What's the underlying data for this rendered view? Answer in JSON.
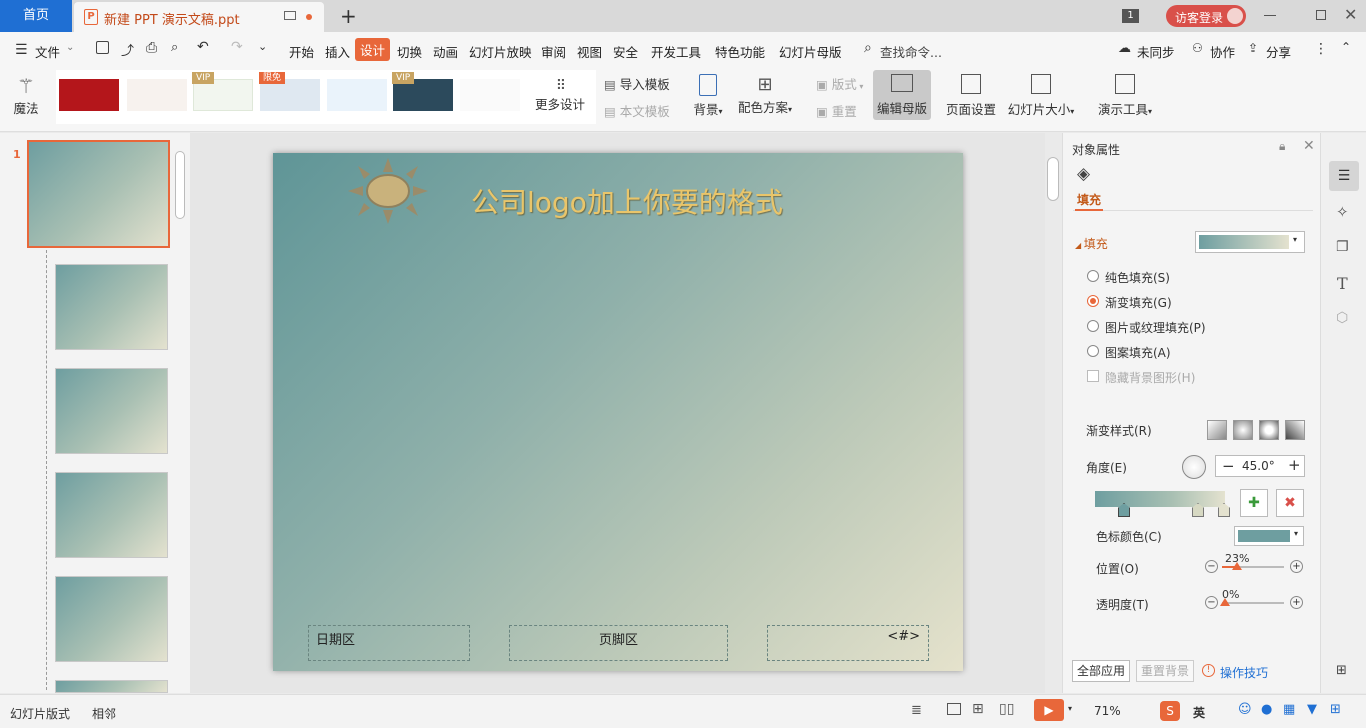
{
  "tabs": {
    "home": "首页",
    "doc_title": "新建 PPT 演示文稿.ppt",
    "badge": "1",
    "login": "访客登录"
  },
  "menu": {
    "file": "文件",
    "items": [
      "开始",
      "插入",
      "设计",
      "切换",
      "动画",
      "幻灯片放映",
      "审阅",
      "视图",
      "安全",
      "开发工具",
      "特色功能",
      "幻灯片母版"
    ],
    "search": "查找命令...",
    "sync": "未同步",
    "collab": "协作",
    "share": "分享"
  },
  "ribbon": {
    "magic": "魔法",
    "vip": "VIP",
    "free": "限免",
    "more_design": "更多设计",
    "import_template": "导入模板",
    "this_template": "本文模板",
    "background": "背景",
    "color_scheme": "配色方案",
    "layout": "版式",
    "reset": "重置",
    "edit_master": "编辑母版",
    "page_setup": "页面设置",
    "slide_size": "幻灯片大小",
    "present_tools": "演示工具"
  },
  "slide": {
    "title": "公司logo加上你要的格式",
    "date": "日期区",
    "footer": "页脚区",
    "number": "<#>"
  },
  "thumbs": {
    "first_number": "1"
  },
  "props": {
    "panel_title": "对象属性",
    "tab_fill": "填充",
    "section_fill": "填充",
    "options": [
      "纯色填充(S)",
      "渐变填充(G)",
      "图片或纹理填充(P)",
      "图案填充(A)"
    ],
    "hide_bg": "隐藏背景图形(H)",
    "gradient_style": "渐变样式(R)",
    "angle_label": "角度(E)",
    "angle_value": "45.0°",
    "stop_color": "色标颜色(C)",
    "position_label": "位置(O)",
    "position_value": "23%",
    "transparency_label": "透明度(T)",
    "transparency_value": "0%",
    "apply_all": "全部应用",
    "reset_bg": "重置背景",
    "tips": "操作技巧"
  },
  "status": {
    "mode": "幻灯片版式",
    "neighbor": "相邻",
    "zoom": "71%",
    "ime": "英"
  },
  "colors": {
    "accent": "#e8673a",
    "home_blue": "#1f6fd3",
    "title_gold": "#e9c56a"
  }
}
